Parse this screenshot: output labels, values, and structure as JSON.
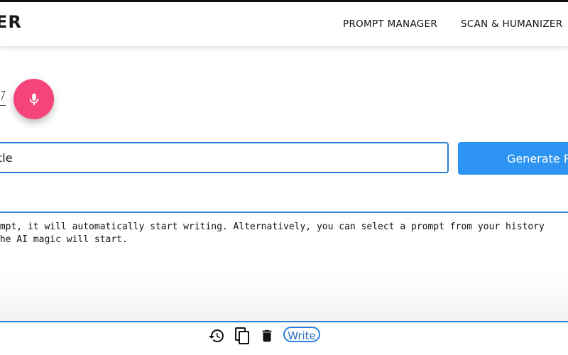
{
  "navbar": {
    "brand": "ER",
    "links": {
      "prompt_manager": "PROMPT MANAGER",
      "scan_humanizer": "SCAN & HUMANIZER"
    }
  },
  "mic": {
    "icon": "microphone-icon"
  },
  "prompt_input": {
    "value": "icle"
  },
  "generate_button": {
    "label": "Generate P"
  },
  "editor": {
    "lines": [
      "ompt, it will automatically start writing. Alternatively, you can select a prompt from your history",
      "the AI magic will start."
    ]
  },
  "toolbar": {
    "icons": [
      "history-icon",
      "copy-icon",
      "delete-icon"
    ],
    "write_label": "Write"
  },
  "colors": {
    "accent_blue": "#2a80d6",
    "button_blue": "#2d94f3",
    "mic_pink": "#f5447a"
  }
}
